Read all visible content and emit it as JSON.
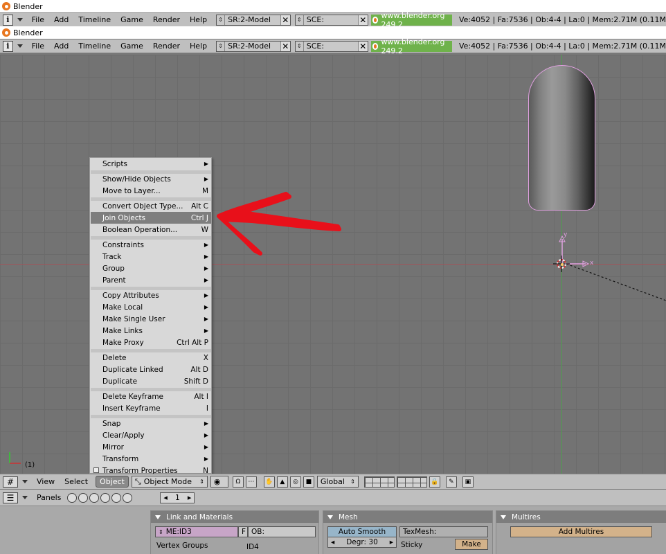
{
  "window": {
    "title": "Blender"
  },
  "top_menu": {
    "items": [
      "File",
      "Add",
      "Timeline",
      "Game",
      "Render",
      "Help"
    ],
    "screen": "SR:2-Model",
    "scene": "SCE:",
    "site": "www.blender.org 249.2",
    "stats": "Ve:4052 | Fa:7536 | Ob:4-4 | La:0 | Mem:2.71M (0.11M"
  },
  "viewport": {
    "axis_x": "x",
    "axis_y": "y",
    "frame": "(1)"
  },
  "object_menu": {
    "items": [
      {
        "label": "Scripts",
        "shortcut": "",
        "submenu": true
      },
      {
        "label": "Show/Hide Objects",
        "shortcut": "",
        "submenu": true
      },
      {
        "label": "Move to Layer...",
        "shortcut": "M",
        "submenu": false
      },
      {
        "label": "Convert Object Type...",
        "shortcut": "Alt C",
        "submenu": false
      },
      {
        "label": "Join Objects",
        "shortcut": "Ctrl J",
        "submenu": false,
        "highlighted": true
      },
      {
        "label": "Boolean Operation...",
        "shortcut": "W",
        "submenu": false
      },
      {
        "label": "Constraints",
        "shortcut": "",
        "submenu": true
      },
      {
        "label": "Track",
        "shortcut": "",
        "submenu": true
      },
      {
        "label": "Group",
        "shortcut": "",
        "submenu": true
      },
      {
        "label": "Parent",
        "shortcut": "",
        "submenu": true
      },
      {
        "label": "Copy Attributes",
        "shortcut": "",
        "submenu": true
      },
      {
        "label": "Make Local",
        "shortcut": "",
        "submenu": true
      },
      {
        "label": "Make Single User",
        "shortcut": "",
        "submenu": true
      },
      {
        "label": "Make Links",
        "shortcut": "",
        "submenu": true
      },
      {
        "label": "Make Proxy",
        "shortcut": "Ctrl Alt P",
        "submenu": false
      },
      {
        "label": "Delete",
        "shortcut": "X",
        "submenu": false
      },
      {
        "label": "Duplicate Linked",
        "shortcut": "Alt D",
        "submenu": false
      },
      {
        "label": "Duplicate",
        "shortcut": "Shift D",
        "submenu": false
      },
      {
        "label": "Delete Keyframe",
        "shortcut": "Alt I",
        "submenu": false
      },
      {
        "label": "Insert Keyframe",
        "shortcut": "I",
        "submenu": false
      },
      {
        "label": "Snap",
        "shortcut": "",
        "submenu": true
      },
      {
        "label": "Clear/Apply",
        "shortcut": "",
        "submenu": true
      },
      {
        "label": "Mirror",
        "shortcut": "",
        "submenu": true
      },
      {
        "label": "Transform",
        "shortcut": "",
        "submenu": true
      },
      {
        "label": "Transform Properties",
        "shortcut": "N",
        "submenu": false,
        "checkbox": true
      }
    ],
    "submenu_glyph": "▶"
  },
  "header_3d": {
    "view": "View",
    "select": "Select",
    "object": "Object",
    "mode": "Object Mode",
    "orientation": "Global"
  },
  "buttons_window": {
    "panels_label": "Panels",
    "frame_value": "1",
    "link_materials": {
      "title": "Link and Materials",
      "mesh_name": "ME:ID3",
      "f_label": "F",
      "ob_name": "OB:",
      "vertex_groups": "Vertex Groups",
      "vg_value": "ID4"
    },
    "mesh": {
      "title": "Mesh",
      "auto_smooth": "Auto Smooth",
      "degr": "Degr: 30",
      "texmesh": "TexMesh:",
      "sticky": "Sticky",
      "make": "Make"
    },
    "multires": {
      "title": "Multires",
      "add_multires": "Add Multires"
    }
  },
  "colors": {
    "viewport_bg": "#737373",
    "menu_bg": "#d8d8d8",
    "menu_highlight": "#7e7e7e",
    "arrow_red": "#e8101a",
    "selection_pink": "#e0a0e0",
    "site_green": "#6fb24b"
  }
}
